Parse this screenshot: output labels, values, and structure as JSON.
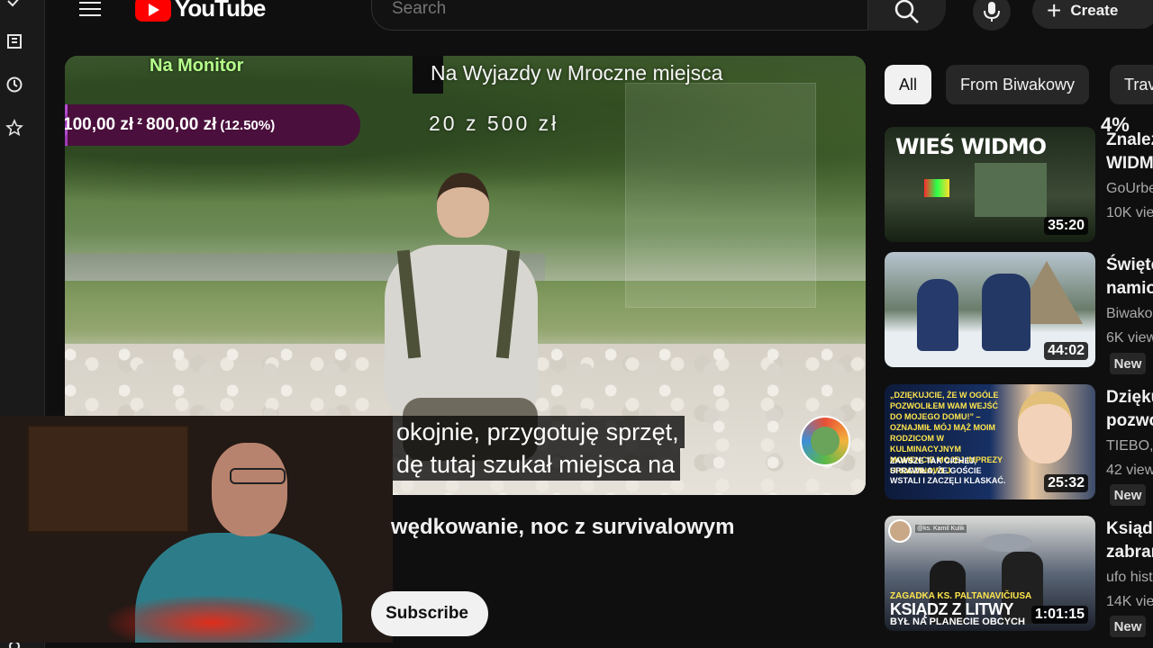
{
  "header": {
    "logo_text": "YouTube",
    "search_placeholder": "Search",
    "create_label": "Create"
  },
  "player": {
    "overlay_title": "Na Wyjazdy w Mroczne miejsca",
    "overlay_count": "20 z 500 zł",
    "monitor_label": "Na Monitor",
    "goal": {
      "current": "100,00 zł",
      "sep": "z",
      "target": "800,00 zł",
      "percent_text": "(12.50%)",
      "progress": 0.125
    },
    "captions": [
      "okojnie, przygotuję sprzęt,",
      "dę tutaj szukał miejsca na"
    ]
  },
  "description": {
    "text": "wędkowanie, noc z survivalowym",
    "subscribe_label": "Subscribe"
  },
  "chips": [
    {
      "label": "All",
      "active": true
    },
    {
      "label": "From Biwakowy",
      "active": false
    },
    {
      "label": "Trav",
      "active": false
    }
  ],
  "percent_badge": "4%",
  "recommendations": [
    {
      "thumb_text": "WIEŚ WIDMO",
      "duration": "35:20",
      "title_lines": [
        "Znalez",
        "WIDM"
      ],
      "channel": "GoUrbe",
      "views": "10K vie",
      "new": ""
    },
    {
      "thumb_text": "",
      "duration": "44:02",
      "title_lines": [
        "Święte",
        "namio"
      ],
      "channel": "Biwako",
      "views": "6K view",
      "new": "New"
    },
    {
      "thumb_text": "„DZIĘKUJCIE, ŻE W OGÓLE POZWOLIŁEM WAM WEJŚĆ DO MOJEGO DOMU!” – OZNAJMIŁ MÓJ MĄŻ MOIM RODZICOM W KULMINACYJNYM MOMENCIE MOJEJ IMPREZY URODZINOWEJ",
      "thumb_text2": "ZAWSZE TAK CICHEJ, SPRAWIŁA, ŻE GOŚCIE WSTALI I ZACZĘLI KLASKAĆ.",
      "duration": "25:32",
      "title_lines": [
        "Dzięku",
        "pozwo"
      ],
      "channel": "TIEBO,",
      "views": "42 view",
      "new": "New"
    },
    {
      "thumb_text": "ZAGADKA KS. PALTANAVIČIUSA",
      "thumb_text2": "KSIĄDZ Z LITWY",
      "thumb_text3": "BYŁ NA PLANECIE OBCYCH",
      "channel_tag": "@ks. Kamil Kulik",
      "duration": "1:01:15",
      "title_lines": [
        "Ksiądz",
        "zabrar"
      ],
      "channel": "ufo hist",
      "views": "14K vie",
      "new": "New"
    }
  ]
}
